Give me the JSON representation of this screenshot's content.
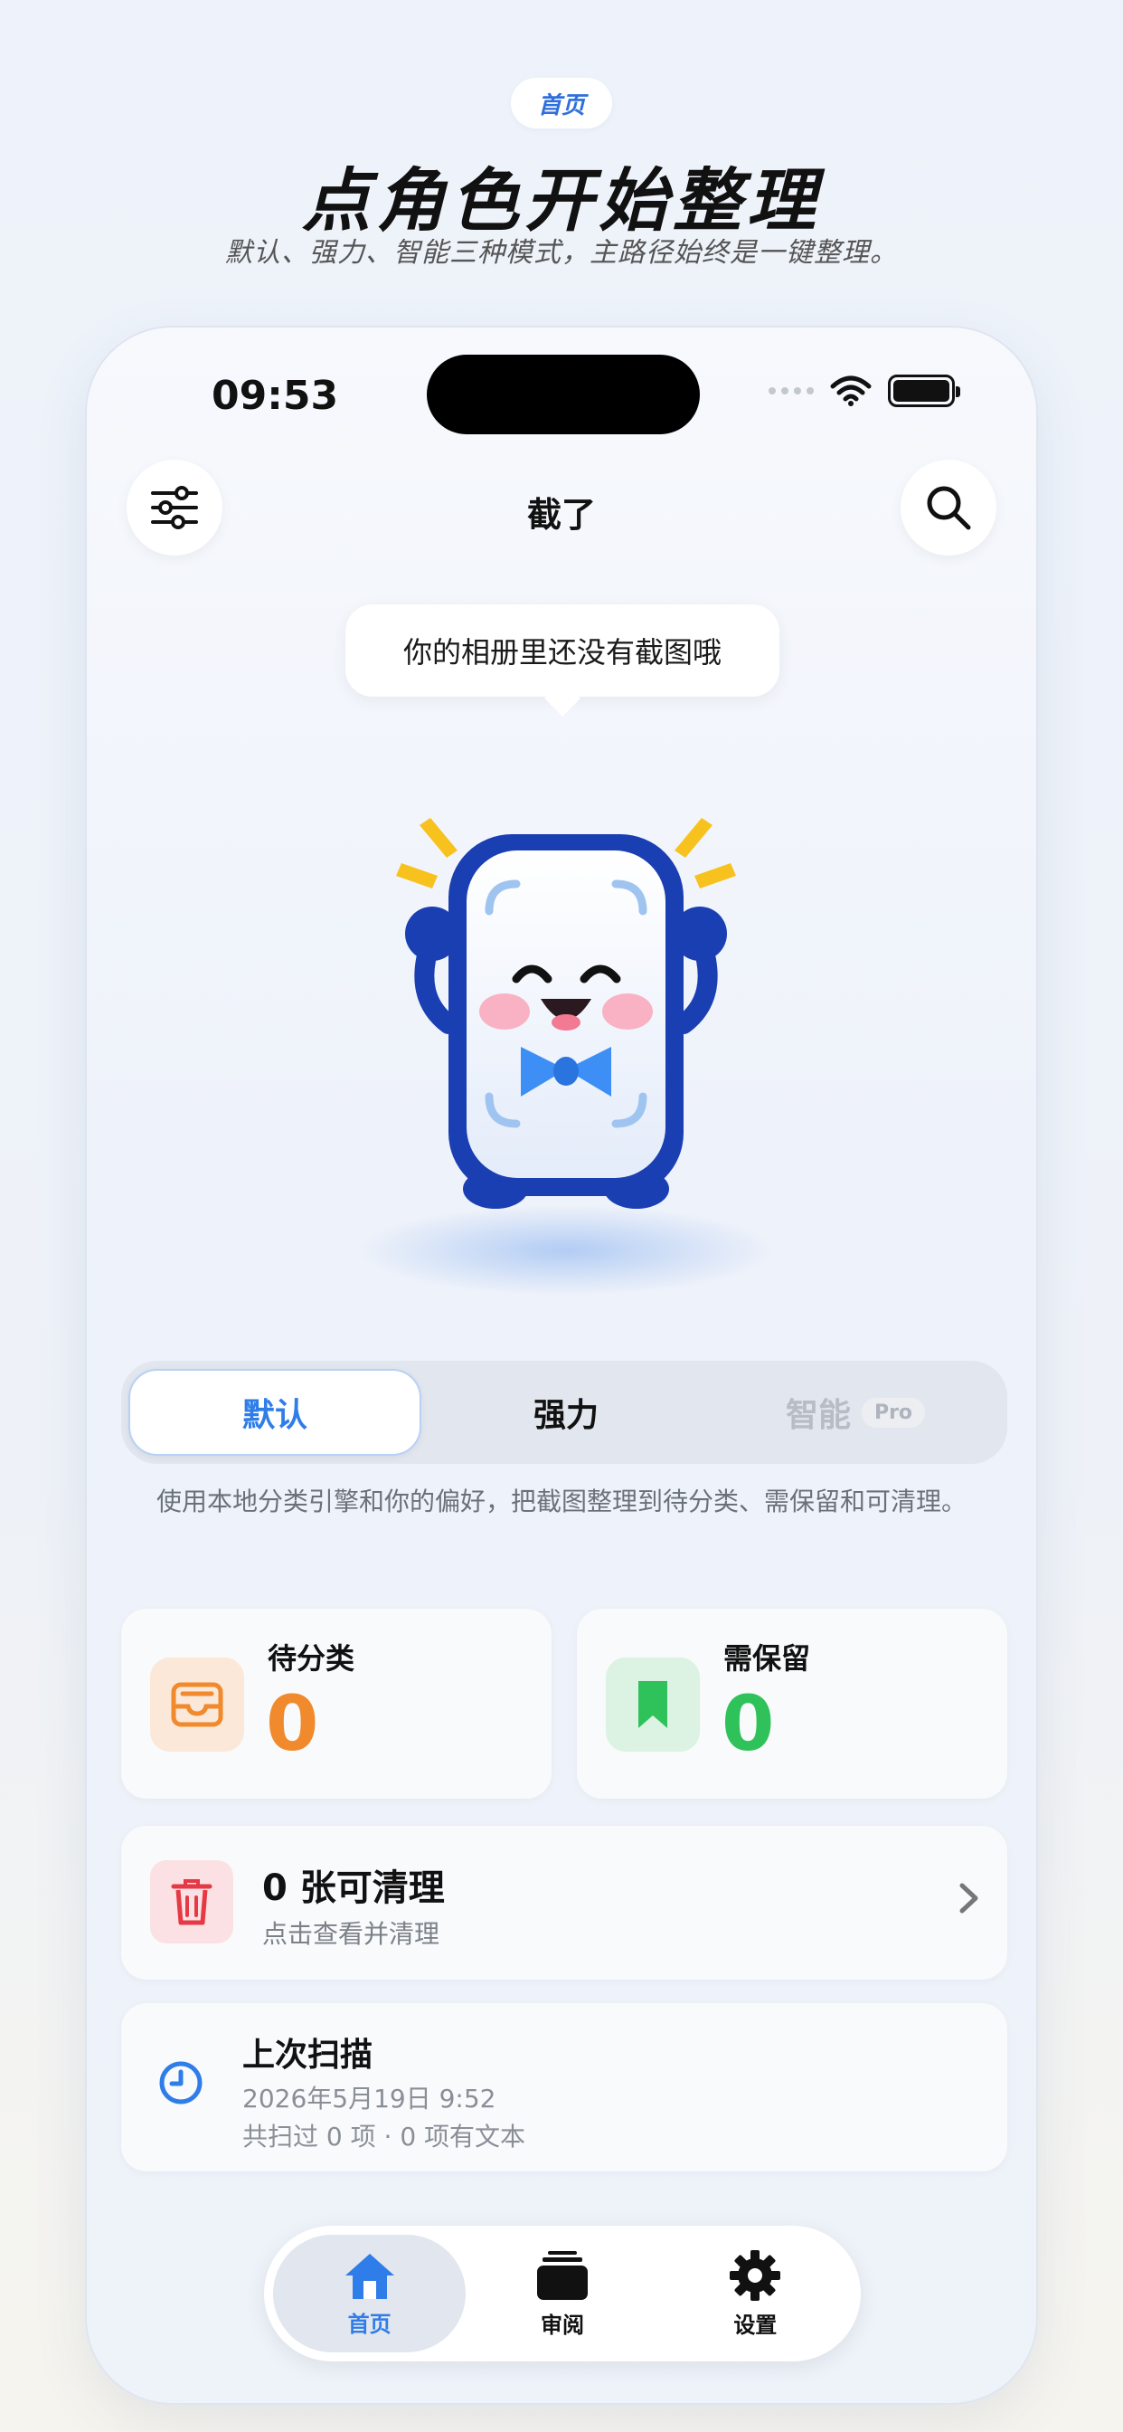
{
  "header": {
    "pill_label": "首页",
    "title": "点角色开始整理",
    "subtitle": "默认、强力、智能三种模式，主路径始终是一键整理。"
  },
  "status_bar": {
    "time": "09:53"
  },
  "nav": {
    "title": "截了",
    "filter_icon": "sliders-icon",
    "search_icon": "search-icon"
  },
  "speech_bubble": "你的相册里还没有截图哦",
  "mascot": {
    "name": "screenshot-mascot"
  },
  "modes": {
    "items": [
      {
        "label": "默认",
        "state": "active"
      },
      {
        "label": "强力",
        "state": "normal"
      },
      {
        "label": "智能",
        "state": "disabled",
        "tag": "Pro"
      }
    ],
    "description": "使用本地分类引擎和你的偏好，把截图整理到待分类、需保留和可清理。"
  },
  "stats": {
    "pending": {
      "label": "待分类",
      "value": "0",
      "color": "#f08a2c",
      "icon": "inbox-tray-icon"
    },
    "keep": {
      "label": "需保留",
      "value": "0",
      "color": "#2fc25b",
      "icon": "bookmark-icon"
    }
  },
  "cleanable": {
    "title": "0 张可清理",
    "subtitle": "点击查看并清理",
    "icon": "trash-icon",
    "color": "#e53945"
  },
  "last_scan": {
    "title": "上次扫描",
    "date": "2026年5月19日 9:52",
    "summary": "共扫过 0 项 · 0 项有文本",
    "icon": "clock-icon"
  },
  "tabbar": {
    "items": [
      {
        "label": "首页",
        "icon": "home-icon",
        "active": true
      },
      {
        "label": "审阅",
        "icon": "stack-icon",
        "active": false
      },
      {
        "label": "设置",
        "icon": "gear-icon",
        "active": false
      }
    ]
  },
  "colors": {
    "accent": "#2f7de8",
    "orange": "#f08a2c",
    "green": "#2fc25b",
    "red": "#e53945"
  }
}
